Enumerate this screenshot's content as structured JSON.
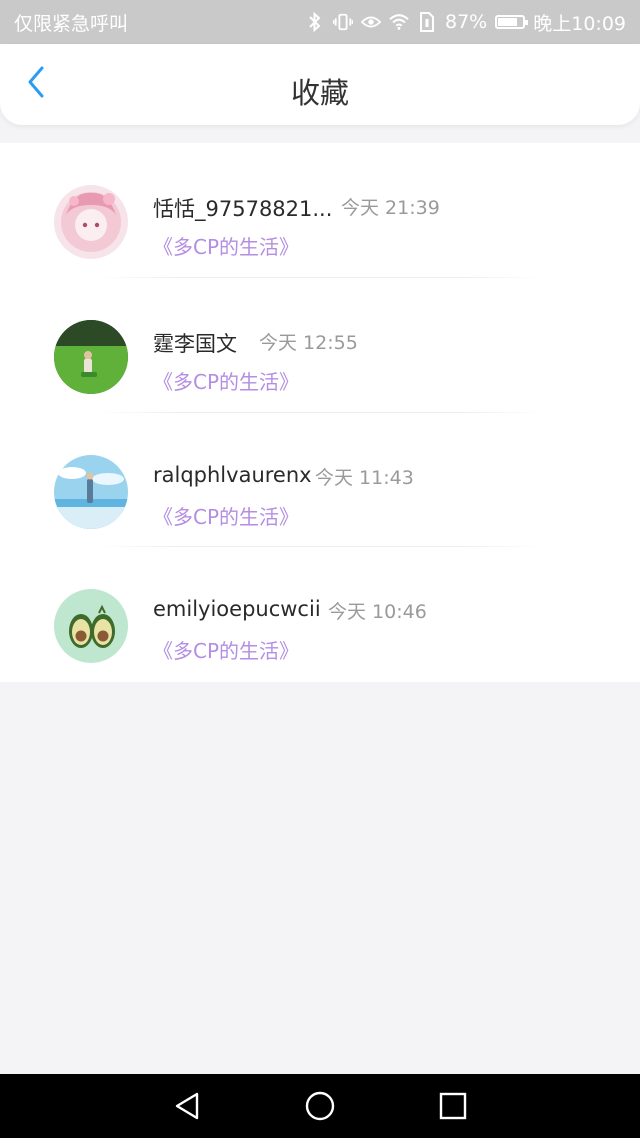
{
  "status_bar": {
    "left_text": "仅限紧急呼叫",
    "battery_text": "87%",
    "battery_level": 0.87,
    "time_text": "晚上10:09",
    "icons": [
      "bluetooth-icon",
      "vibrate-icon",
      "eye-icon",
      "wifi-icon",
      "sim-icon",
      "battery-icon"
    ]
  },
  "header": {
    "title": "收藏",
    "back_icon": "chevron-left-icon",
    "accent_color": "#2b9cf2"
  },
  "favorites": [
    {
      "username": "恬恬_97578821...",
      "time": "今天 21:39",
      "book": "《多CP的生活》",
      "avatar": "anime-girl-avatar"
    },
    {
      "username": "霆李国文",
      "time": "今天 12:55",
      "book": "《多CP的生活》",
      "avatar": "grass-field-avatar"
    },
    {
      "username": "ralqphlvaurenx",
      "time": "今天 11:43",
      "book": "《多CP的生活》",
      "avatar": "sky-sea-avatar"
    },
    {
      "username": "emilyioepucwcii",
      "time": "今天 10:46",
      "book": "《多CP的生活》",
      "avatar": "avocado-avatar"
    }
  ],
  "colors": {
    "book_title": "#b48ee3",
    "time": "#9a9a9a",
    "background": "#f4f4f6"
  },
  "nav_bar": {
    "buttons": [
      "back-triangle-icon",
      "home-circle-icon",
      "recents-square-icon"
    ]
  }
}
